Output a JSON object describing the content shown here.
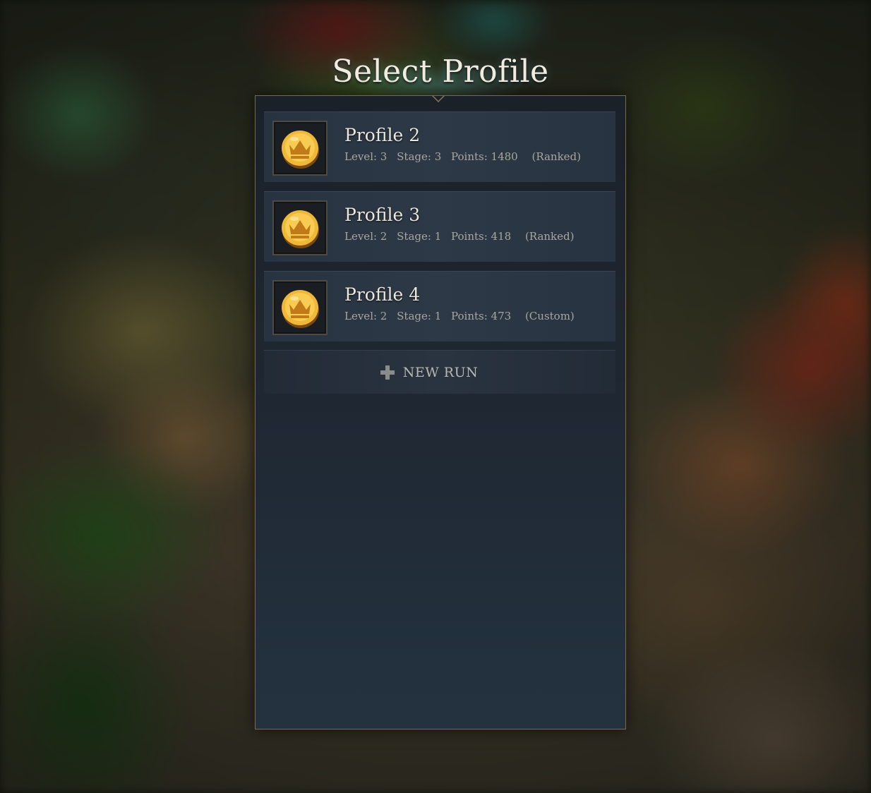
{
  "screen": {
    "title": "Select Profile"
  },
  "profiles": [
    {
      "name": "Profile 2",
      "level_label": "Level: 3",
      "stage_label": "Stage: 3",
      "points_label": "Points: 1480",
      "mode_label": "(Ranked)",
      "icon": "crown-coin-icon"
    },
    {
      "name": "Profile 3",
      "level_label": "Level: 2",
      "stage_label": "Stage: 1",
      "points_label": "Points: 418",
      "mode_label": "(Ranked)",
      "icon": "crown-coin-icon"
    },
    {
      "name": "Profile 4",
      "level_label": "Level: 2",
      "stage_label": "Stage: 1",
      "points_label": "Points: 473",
      "mode_label": "(Custom)",
      "icon": "crown-coin-icon"
    }
  ],
  "new_run": {
    "label": "NEW RUN",
    "icon": "plus-icon"
  },
  "colors": {
    "panel_border": "#7a6a45",
    "coin_gold": "#e8b53a",
    "title_text": "#f2ece0"
  }
}
